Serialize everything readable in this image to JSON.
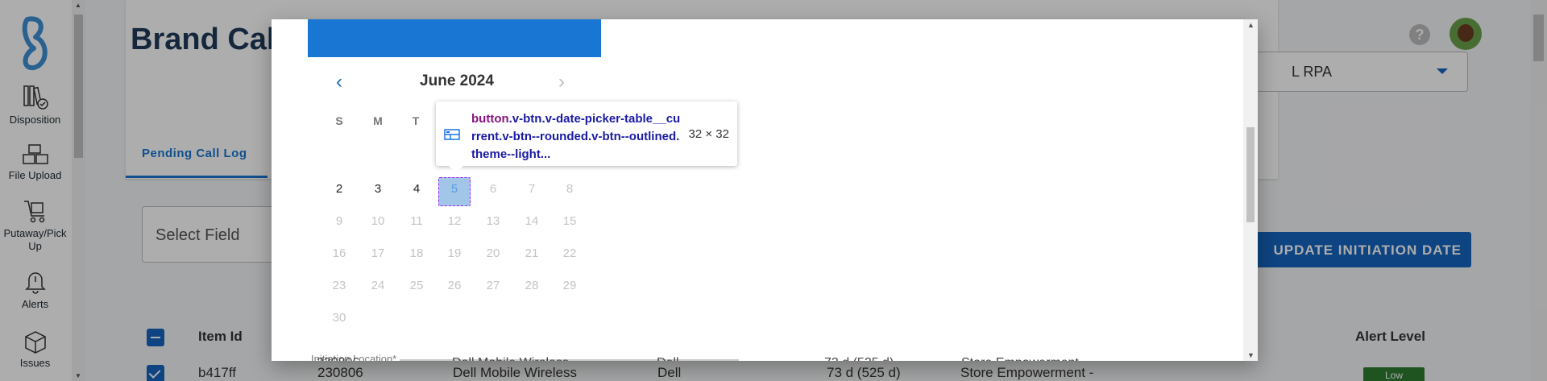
{
  "sidebar": {
    "items": [
      {
        "label": "Disposition",
        "icon": "books-check-icon"
      },
      {
        "label": "File Upload",
        "icon": "boxes-icon"
      },
      {
        "label": "Putaway/Pick Up",
        "icon": "cart-icon"
      },
      {
        "label": "Alerts",
        "icon": "bell-icon"
      },
      {
        "label": "Issues",
        "icon": "package-icon"
      }
    ]
  },
  "header": {
    "title": "Brand Cal",
    "rpa_select_value": "L RPA"
  },
  "tabs": {
    "pending_label": "Pending Call Log"
  },
  "filters": {
    "select_field_label": "Select Field",
    "update_button": "UPDATE INITIATION DATE"
  },
  "table": {
    "headers": {
      "item_id": "Item Id",
      "alert_level": "Alert Level"
    },
    "row": {
      "item_id": "b417ff",
      "col2": "230806",
      "col3": "Dell Mobile Wireless",
      "col4": "Dell",
      "col5": "73 d (525 d)",
      "col6": "Store Empowerment -",
      "alert": "Low"
    }
  },
  "date_picker": {
    "month_label": "June 2024",
    "weekdays": [
      "S",
      "M",
      "T"
    ],
    "weeks": [
      [
        "2",
        "3",
        "4",
        "5",
        "6",
        "7",
        "8"
      ],
      [
        "9",
        "10",
        "11",
        "12",
        "13",
        "14",
        "15"
      ],
      [
        "16",
        "17",
        "18",
        "19",
        "20",
        "21",
        "22"
      ],
      [
        "23",
        "24",
        "25",
        "26",
        "27",
        "28",
        "29"
      ],
      [
        "30"
      ]
    ],
    "current_day": "5",
    "initiation_location_label": "Initiation Location*",
    "colors": {
      "header": "#1976d2",
      "accent": "#1565c0"
    }
  },
  "devtools_tooltip": {
    "tag": "button",
    "selector": ".v-btn.v-date-picker-table__current.v-btn--rounded.v-btn--outlined.theme--light...",
    "size": "32 × 32"
  }
}
